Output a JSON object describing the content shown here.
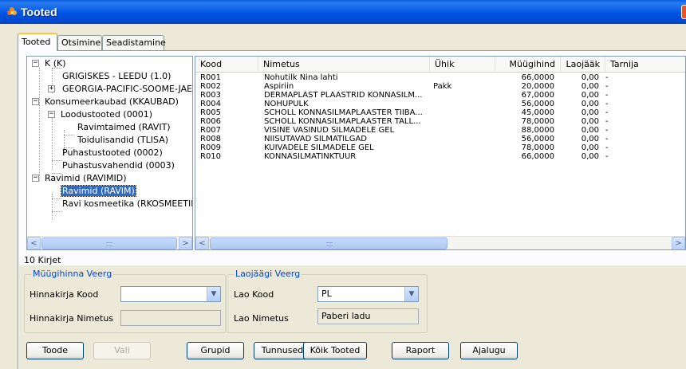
{
  "window": {
    "title": "Tooted",
    "icon": "app-flower-icon"
  },
  "tabs": [
    {
      "label": "Tooted",
      "active": true
    },
    {
      "label": "Otsimine",
      "active": false
    },
    {
      "label": "Seadistamine",
      "active": false
    }
  ],
  "tree": [
    {
      "label": "K (K)",
      "expander": "−"
    },
    {
      "label": "GRIGISKES - LEEDU (1.0)"
    },
    {
      "label": "GEORGIA-PACIFIC-SOOME-JAE",
      "expander": "+"
    },
    {
      "label": "Konsumeerkaubad (KKAUBAD)",
      "expander": "−"
    },
    {
      "label": "Loodustooted (0001)",
      "expander": "−"
    },
    {
      "label": "Ravimtaimed (RAVIT)"
    },
    {
      "label": "Toidulisandid (TLISA)"
    },
    {
      "label": "Puhastustooted (0002)"
    },
    {
      "label": "Puhastusvahendid (0003)"
    },
    {
      "label": "Ravimid (RAVIMID)",
      "expander": "−"
    },
    {
      "label": "Ravimid (RAVIM)",
      "selected": true
    },
    {
      "label": "Ravi kosmeetika (RKOSMEETIKA"
    }
  ],
  "grid": {
    "columns": [
      "Kood",
      "Nimetus",
      "Ühik",
      "Müügihind",
      "Laojääk",
      "Tarnija"
    ],
    "rows": [
      [
        "R001",
        "Nohutilk Nina lahti",
        "",
        "66,0000",
        "0,00",
        "-"
      ],
      [
        "R002",
        "Aspiriin",
        "Pakk",
        "20,0000",
        "0,00",
        "-"
      ],
      [
        "R003",
        "DERMAPLAST PLAASTRID KONNASILM...",
        "",
        "67,0000",
        "0,00",
        "-"
      ],
      [
        "R004",
        "NOHUPULK",
        "",
        "56,0000",
        "0,00",
        "-"
      ],
      [
        "R005",
        "SCHOLL KONNASILMAPLAASTER TIIBA...",
        "",
        "45,0000",
        "0,00",
        "-"
      ],
      [
        "R006",
        "SCHOLL KONNASILMAPLAASTER TALL...",
        "",
        "78,0000",
        "0,00",
        "-"
      ],
      [
        "R007",
        "VISINE VÄSINUD SILMADELE GEL",
        "",
        "88,0000",
        "0,00",
        "-"
      ],
      [
        "R008",
        "NIISUTAVAD SILMATILGAD",
        "",
        "56,0000",
        "0,00",
        "-"
      ],
      [
        "R009",
        "KUIVADELE SILMADELE GEL",
        "",
        "78,0000",
        "0,00",
        "-"
      ],
      [
        "R010",
        "KONNASILMATINKTUUR",
        "",
        "66,0000",
        "0,00",
        "-"
      ]
    ]
  },
  "status": {
    "count": "10 Kirjet"
  },
  "muugihinna": {
    "title": "Müügihinna Veerg",
    "kood_label": "Hinnakirja Kood",
    "kood_value": "",
    "nimetus_label": "Hinnakirja Nimetus",
    "nimetus_value": ""
  },
  "laojaagi": {
    "title": "Laojäägi Veerg",
    "kood_label": "Lao Kood",
    "kood_value": "PL",
    "nimetus_label": "Lao Nimetus",
    "nimetus_value": "Paberi ladu"
  },
  "buttons": {
    "toode": "Toode",
    "vali": "Vali",
    "grupid": "Grupid",
    "tunnused": "Tunnused",
    "koik": "Kõik Tooted",
    "raport": "Raport",
    "ajalugu": "Ajalugu"
  },
  "scroll": {
    "left": "<",
    "right": ">"
  },
  "colors": {
    "titlebar": "#0055e5",
    "selection": "#316ac5",
    "group_title": "#0046d5"
  }
}
